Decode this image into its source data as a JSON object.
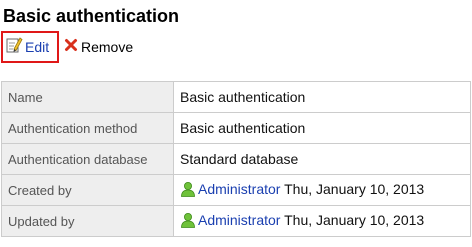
{
  "page": {
    "title": "Basic authentication"
  },
  "toolbar": {
    "edit_label": "Edit",
    "remove_label": "Remove",
    "edit_highlight_color": "#e01818"
  },
  "details": {
    "name": {
      "label": "Name",
      "value": "Basic authentication"
    },
    "method": {
      "label": "Authentication method",
      "value": "Basic authentication"
    },
    "database": {
      "label": "Authentication database",
      "value": "Standard database"
    },
    "created": {
      "label": "Created by",
      "user": "Administrator",
      "date": "Thu, January 10, 2013"
    },
    "updated": {
      "label": "Updated by",
      "user": "Administrator",
      "date": "Thu, January 10, 2013"
    }
  },
  "icons": {
    "edit": "edit-pencil-icon",
    "remove": "remove-x-icon",
    "user": "user-icon"
  },
  "colors": {
    "link": "#1a3fb0",
    "label_bg": "#eeeeee",
    "border": "#cccccc"
  }
}
